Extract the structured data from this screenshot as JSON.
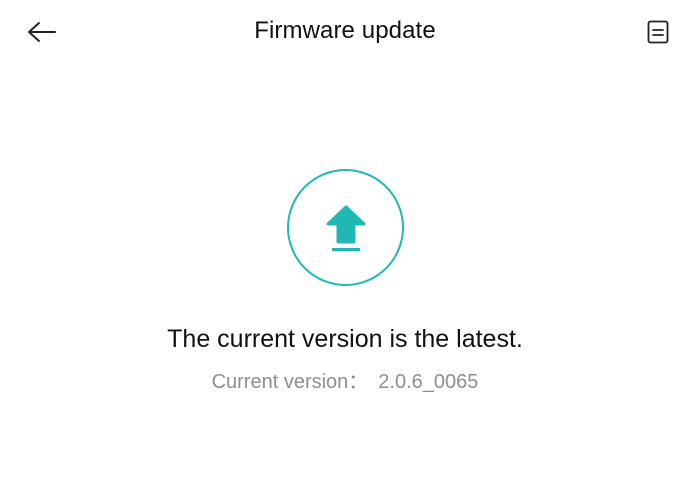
{
  "header": {
    "title": "Firmware update",
    "back_icon": "arrow-left-icon",
    "log_icon": "document-list-icon"
  },
  "status": {
    "icon": "upload-arrow-icon",
    "accent_color": "#1fb8b3",
    "message": "The current version is the latest.",
    "version_label": "Current version：",
    "version_value": "2.0.6_0065"
  }
}
